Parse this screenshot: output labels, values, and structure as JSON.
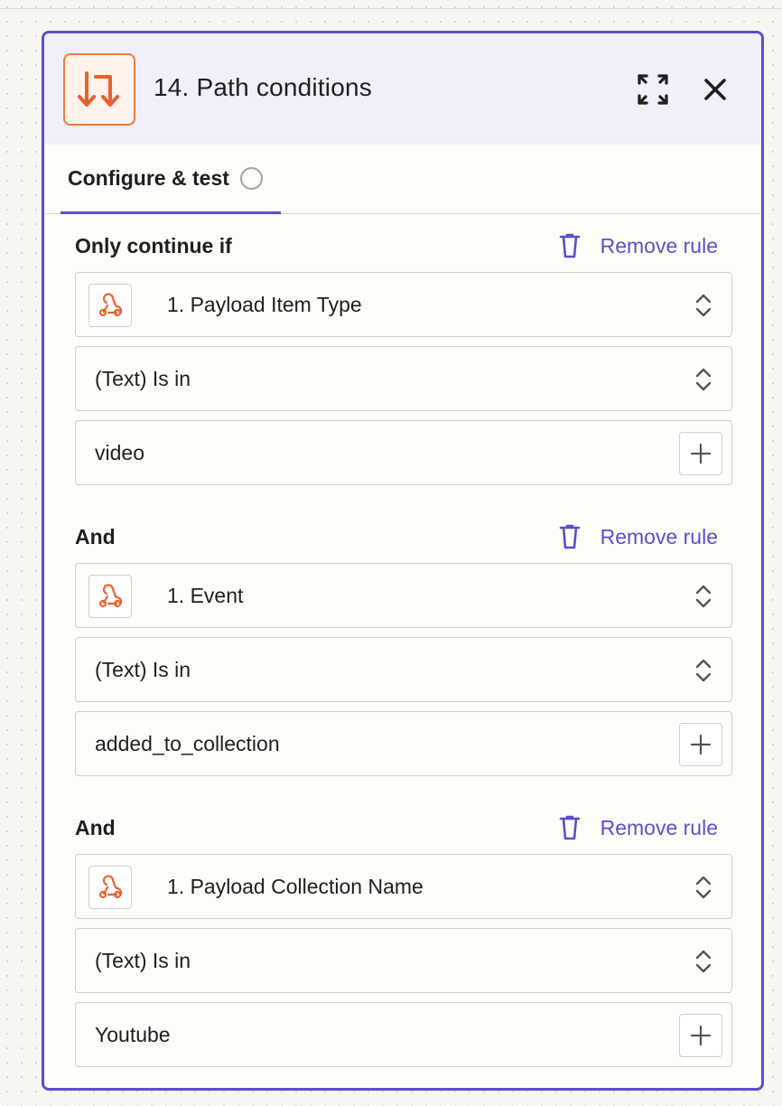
{
  "panel": {
    "title": "14. Path conditions",
    "app_icon": "paths-icon",
    "accent_color": "#5b4fcf",
    "brand_color": "#f27a3c"
  },
  "tabs": [
    {
      "label": "Configure & test",
      "status": "incomplete"
    }
  ],
  "rules": [
    {
      "label": "Only continue if",
      "remove_label": "Remove rule",
      "field": "1. Payload Item Type",
      "condition": "(Text) Is in",
      "value": "video"
    },
    {
      "label": "And",
      "remove_label": "Remove rule",
      "field": "1. Event",
      "condition": "(Text) Is in",
      "value": "added_to_collection"
    },
    {
      "label": "And",
      "remove_label": "Remove rule",
      "field": "1. Payload Collection Name",
      "condition": "(Text) Is in",
      "value": "Youtube"
    }
  ]
}
